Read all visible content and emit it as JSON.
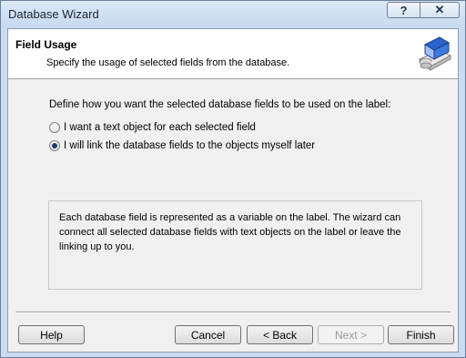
{
  "window": {
    "title": "Database Wizard",
    "help_glyph": "?",
    "close_glyph": "✕"
  },
  "header": {
    "title": "Field Usage",
    "subtitle": "Specify the usage of selected fields from the database.",
    "icon": "database-wizard-icon"
  },
  "body": {
    "prompt": "Define how you want the selected database fields to be used on the label:",
    "options": [
      {
        "label": "I want a text object for each selected field",
        "checked": false
      },
      {
        "label": "I will link the database fields to the objects myself later",
        "checked": true
      }
    ],
    "info": "Each database field is represented as a variable on the label. The wizard can connect all selected database fields with text objects on the label or leave the linking up to you."
  },
  "buttons": {
    "help": "Help",
    "cancel": "Cancel",
    "back": "< Back",
    "next": "Next >",
    "finish": "Finish"
  }
}
